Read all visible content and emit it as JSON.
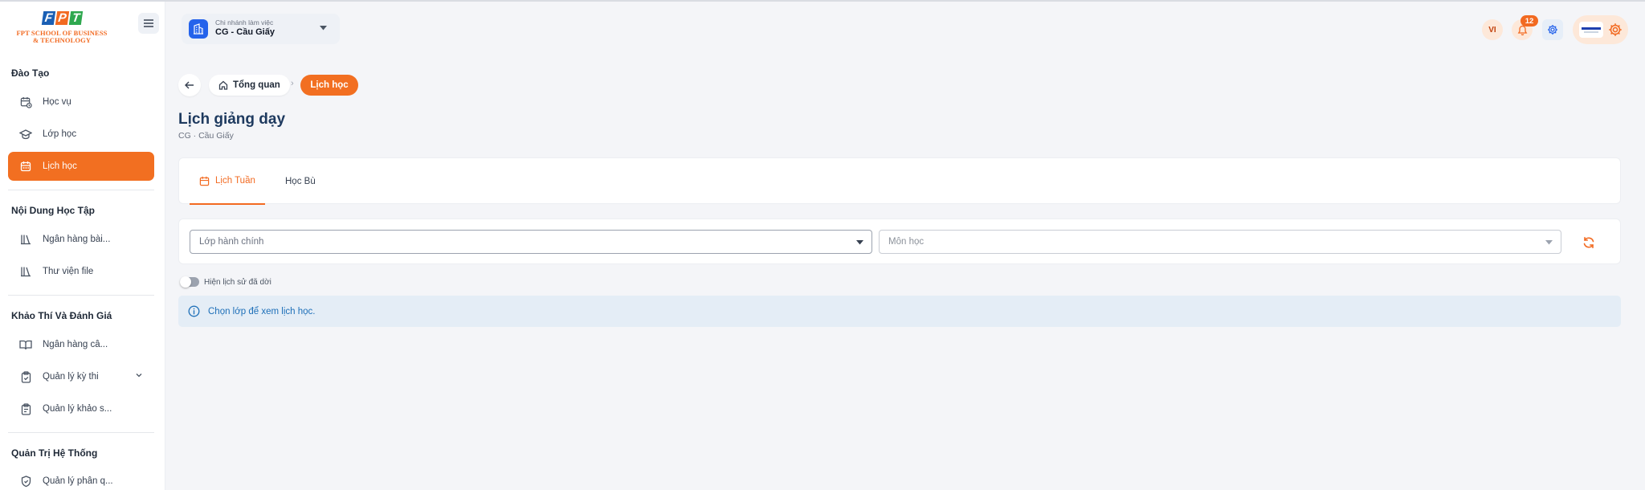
{
  "brand": {
    "logo_letters": [
      "F",
      "P",
      "T"
    ],
    "school_line1": "FPT SCHOOL OF BUSINESS",
    "school_line2": "& TECHNOLOGY"
  },
  "sidebar": {
    "sections": [
      {
        "title": "Đào Tạo",
        "items": [
          {
            "label": "Học vụ",
            "icon": "calendar-clock-icon",
            "active": false
          },
          {
            "label": "Lớp học",
            "icon": "graduation-cap-icon",
            "active": false
          },
          {
            "label": "Lịch học",
            "icon": "calendar-icon",
            "active": true
          }
        ]
      },
      {
        "title": "Nội Dung Học Tập",
        "items": [
          {
            "label": "Ngân hàng bài...",
            "icon": "library-icon"
          },
          {
            "label": "Thư viện file",
            "icon": "library-icon"
          }
        ]
      },
      {
        "title": "Khảo Thí Và Đánh Giá",
        "items": [
          {
            "label": "Ngân hàng câ...",
            "icon": "book-open-icon"
          },
          {
            "label": "Quản lý kỳ thi",
            "icon": "clipboard-check-icon",
            "has_submenu": true
          },
          {
            "label": "Quản lý khảo s...",
            "icon": "clipboard-list-icon"
          }
        ]
      },
      {
        "title": "Quản Trị Hệ Thống",
        "items": [
          {
            "label": "Quản lý phân q...",
            "icon": "shield-icon"
          }
        ]
      }
    ]
  },
  "header": {
    "branch_caption": "Chi nhánh làm việc",
    "branch_name": "CG - Cầu Giấy",
    "language": "VI",
    "notification_count": "12"
  },
  "breadcrumb": {
    "home": "Tổng quan",
    "separator": "›",
    "current": "Lịch học"
  },
  "page": {
    "title": "Lịch giảng dạy",
    "subtitle": "CG · Cầu Giấy"
  },
  "tabs": [
    {
      "label": "Lịch Tuần",
      "active": true
    },
    {
      "label": "Học Bù",
      "active": false
    }
  ],
  "filters": {
    "class_placeholder": "Lớp hành chính",
    "subject_placeholder": "Môn học"
  },
  "toggle": {
    "label": "Hiện lịch sử đã dời",
    "on": false
  },
  "info": {
    "message": "Chọn lớp để xem lịch học."
  },
  "colors": {
    "accent": "#f26f21",
    "title": "#1e3a5f",
    "info_bg": "#e4edf6",
    "info_text": "#1d6fb8"
  }
}
